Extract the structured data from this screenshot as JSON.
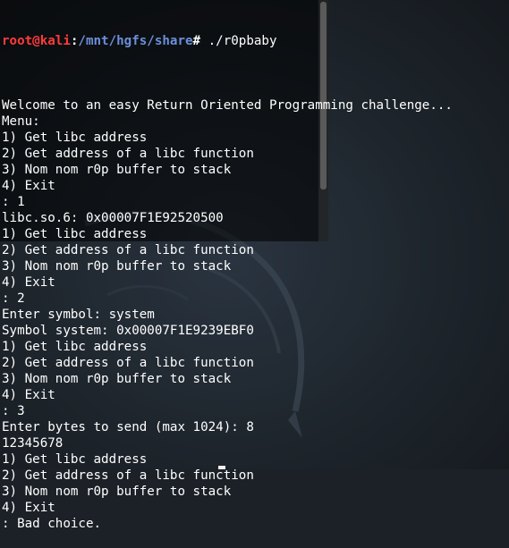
{
  "prompt": {
    "user_host": "root@kali",
    "sep": ":",
    "path": "/mnt/hgfs/share",
    "symbol": "# ",
    "command": "./r0pbaby"
  },
  "output_lines": [
    "",
    "Welcome to an easy Return Oriented Programming challenge...",
    "Menu:",
    "1) Get libc address",
    "2) Get address of a libc function",
    "3) Nom nom r0p buffer to stack",
    "4) Exit",
    ": 1",
    "libc.so.6: 0x00007F1E92520500",
    "1) Get libc address",
    "2) Get address of a libc function",
    "3) Nom nom r0p buffer to stack",
    "4) Exit",
    ": 2",
    "Enter symbol: system",
    "Symbol system: 0x00007F1E9239EBF0",
    "1) Get libc address",
    "2) Get address of a libc function",
    "3) Nom nom r0p buffer to stack",
    "4) Exit",
    ": 3",
    "Enter bytes to send (max 1024): 8",
    "12345678",
    "1) Get libc address",
    "2) Get address of a libc function",
    "3) Nom nom r0p buffer to stack",
    "4) Exit",
    ": Bad choice."
  ],
  "colors": {
    "user_host": "#ff3b3b",
    "path": "#6c8fd9",
    "text": "#ffffff"
  }
}
